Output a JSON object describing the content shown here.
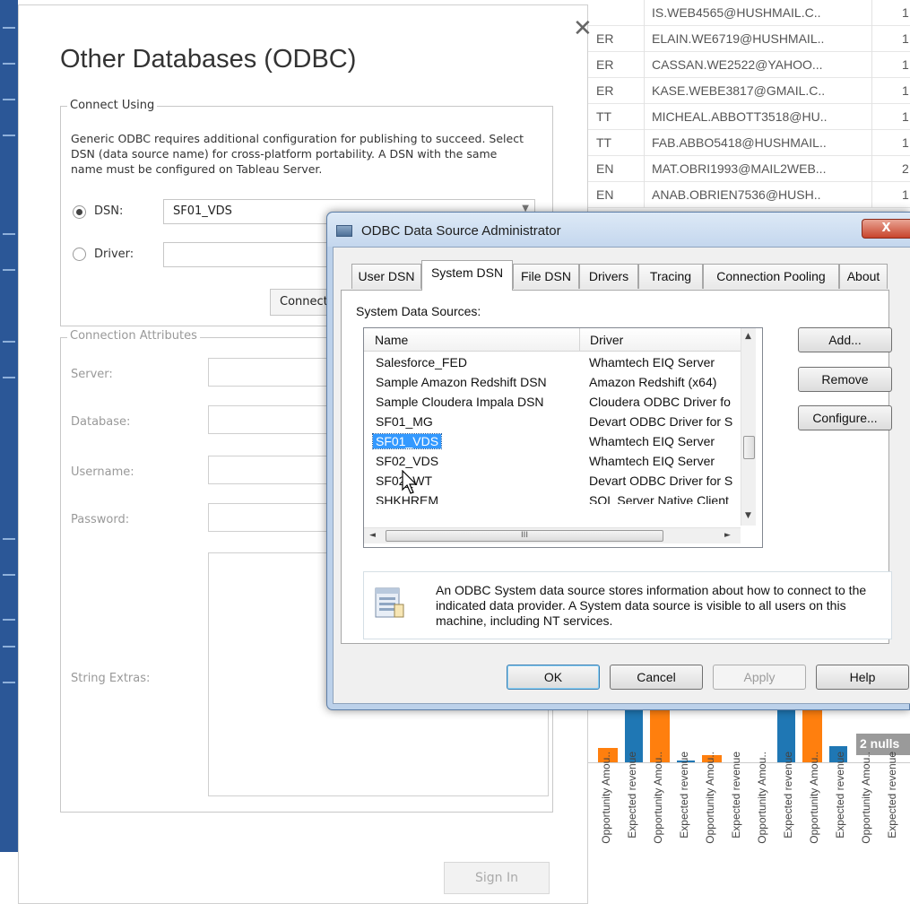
{
  "background_table": {
    "rows": [
      {
        "c1": "",
        "email": "IS.WEB4565@HUSHMAIL.C..",
        "n": "1"
      },
      {
        "c1": "ER",
        "email": "ELAIN.WE6719@HUSHMAIL..",
        "n": "1"
      },
      {
        "c1": "ER",
        "email": "CASSAN.WE2522@YAHOO...",
        "n": "1"
      },
      {
        "c1": "ER",
        "email": "KASE.WEBE3817@GMAIL.C..",
        "n": "1"
      },
      {
        "c1": "TT",
        "email": "MICHEAL.ABBOTT3518@HU..",
        "n": "1"
      },
      {
        "c1": "TT",
        "email": "FAB.ABBO5418@HUSHMAIL..",
        "n": "1"
      },
      {
        "c1": "EN",
        "email": "MAT.OBRI1993@MAIL2WEB...",
        "n": "2"
      },
      {
        "c1": "EN",
        "email": "ANAB.OBRIEN7536@HUSH..",
        "n": "1"
      }
    ]
  },
  "background_chart": {
    "x_labels": [
      "Opportunity Amou..",
      "Expected revenue",
      "Opportunity Amou..",
      "Expected revenue",
      "Opportunity Amou..",
      "Expected revenue",
      "Opportunity Amou..",
      "Expected revenue",
      "Opportunity Amou..",
      "Expected revenue",
      "Opportunity Amou..",
      "Expected revenue"
    ],
    "nulls_badge": "2 nulls",
    "colors": {
      "blue": "#1f77b4",
      "orange": "#ff7f0e"
    }
  },
  "odbc_dialog": {
    "title": "Other Databases (ODBC)",
    "close_glyph": "✕",
    "connect_using": {
      "legend": "Connect Using",
      "help_text": "Generic ODBC requires additional configuration for publishing to succeed. Select DSN (data source name) for cross-platform portability. A DSN with the same name must be configured on Tableau Server.",
      "dsn_label": "DSN:",
      "dsn_value": "SF01_VDS",
      "driver_label": "Driver:",
      "driver_value": "",
      "connect_button": "Connect"
    },
    "attributes": {
      "legend": "Connection Attributes",
      "server_label": "Server:",
      "database_label": "Database:",
      "username_label": "Username:",
      "password_label": "Password:",
      "string_extras_label": "String Extras:"
    },
    "sign_in_button": "Sign In"
  },
  "odbc_admin": {
    "title": "ODBC Data Source Administrator",
    "close_glyph": "X",
    "tabs": [
      "User DSN",
      "System DSN",
      "File DSN",
      "Drivers",
      "Tracing",
      "Connection Pooling",
      "About"
    ],
    "active_tab": "System DSN",
    "section_label": "System Data Sources:",
    "columns": {
      "name": "Name",
      "driver": "Driver"
    },
    "rows": [
      {
        "name": "Salesforce_FED",
        "driver": "Whamtech EIQ Server"
      },
      {
        "name": "Sample Amazon Redshift DSN",
        "driver": "Amazon Redshift (x64)"
      },
      {
        "name": "Sample Cloudera Impala DSN",
        "driver": "Cloudera ODBC Driver fo"
      },
      {
        "name": "SF01_MG",
        "driver": "Devart ODBC Driver for S"
      },
      {
        "name": "SF01_VDS",
        "driver": "Whamtech EIQ Server"
      },
      {
        "name": "SF02_VDS",
        "driver": "Whamtech EIQ Server"
      },
      {
        "name": "SF02_WT",
        "driver": "Devart ODBC Driver for S"
      },
      {
        "name": "SHKHREM",
        "driver": "SQL Server Native Client"
      }
    ],
    "selected_row": "SF01_VDS",
    "scroll_grip": "III",
    "buttons": {
      "add": "Add...",
      "remove": "Remove",
      "configure": "Configure..."
    },
    "info_text": "An ODBC System data source stores information about how to connect to the indicated data provider.  A System data source is visible to all users on this machine, including NT services.",
    "footer": {
      "ok": "OK",
      "cancel": "Cancel",
      "apply": "Apply",
      "help": "Help"
    }
  }
}
